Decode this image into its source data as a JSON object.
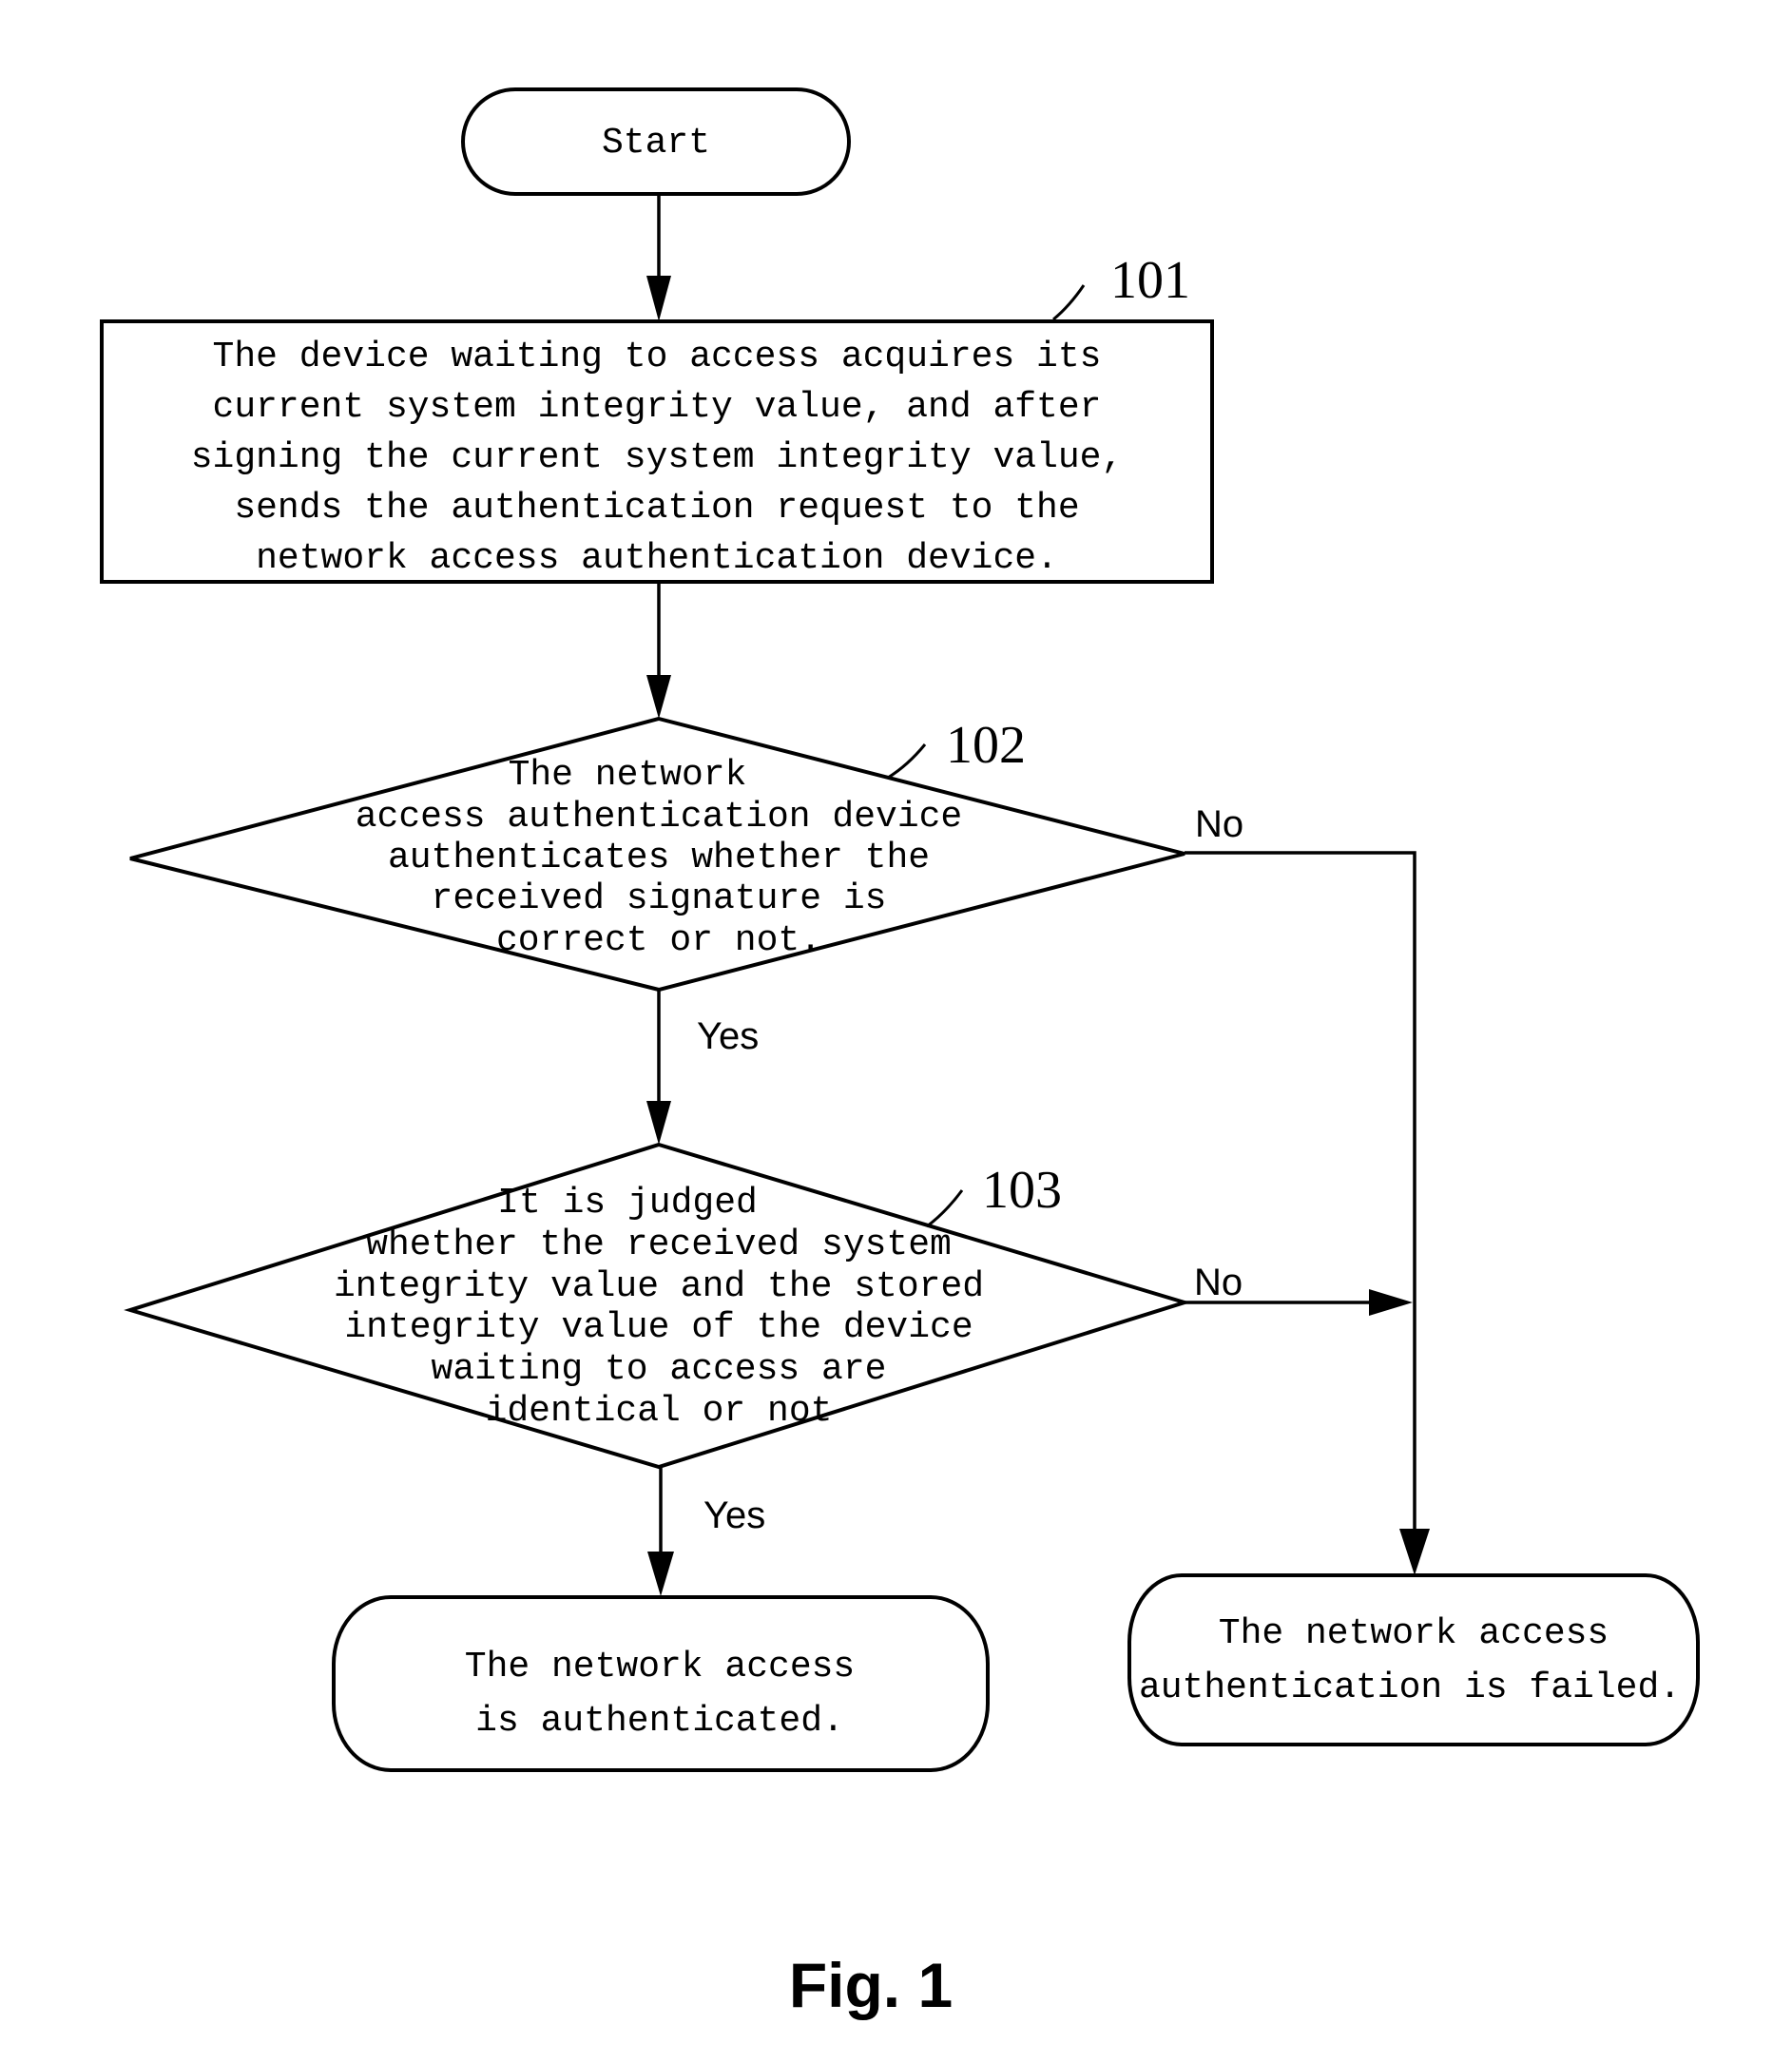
{
  "figure": {
    "caption": "Fig. 1",
    "nodes": {
      "start": {
        "type": "terminal",
        "label": "Start"
      },
      "step101": {
        "type": "process",
        "ref": "101",
        "lines": [
          "The device waiting to access acquires its",
          "current system integrity value, and after",
          "signing the current system integrity value,",
          "sends the authentication request to the",
          "network access authentication device."
        ]
      },
      "step102": {
        "type": "decision",
        "ref": "102",
        "lines": [
          "The network",
          "access authentication device",
          "authenticates whether the",
          "received signature is",
          "correct or not."
        ]
      },
      "step103": {
        "type": "decision",
        "ref": "103",
        "lines": [
          "It is judged",
          "whether the received system",
          "integrity value and the stored",
          "integrity value of the device",
          "waiting to access are",
          "identical or not"
        ]
      },
      "success": {
        "type": "terminal",
        "lines": [
          "The network access",
          "is authenticated."
        ]
      },
      "failure": {
        "type": "terminal",
        "lines": [
          "The network access",
          "authentication is failed."
        ]
      }
    },
    "edges": [
      {
        "from": "start",
        "to": "step101",
        "label": ""
      },
      {
        "from": "step101",
        "to": "step102",
        "label": ""
      },
      {
        "from": "step102",
        "to": "step103",
        "label": "Yes"
      },
      {
        "from": "step102",
        "to": "failure",
        "label": "No"
      },
      {
        "from": "step103",
        "to": "success",
        "label": "Yes"
      },
      {
        "from": "step103",
        "to": "failure",
        "label": "No"
      }
    ],
    "branch_labels": {
      "yes_102": "Yes",
      "no_102": "No",
      "yes_103": "Yes",
      "no_103": "No"
    }
  }
}
